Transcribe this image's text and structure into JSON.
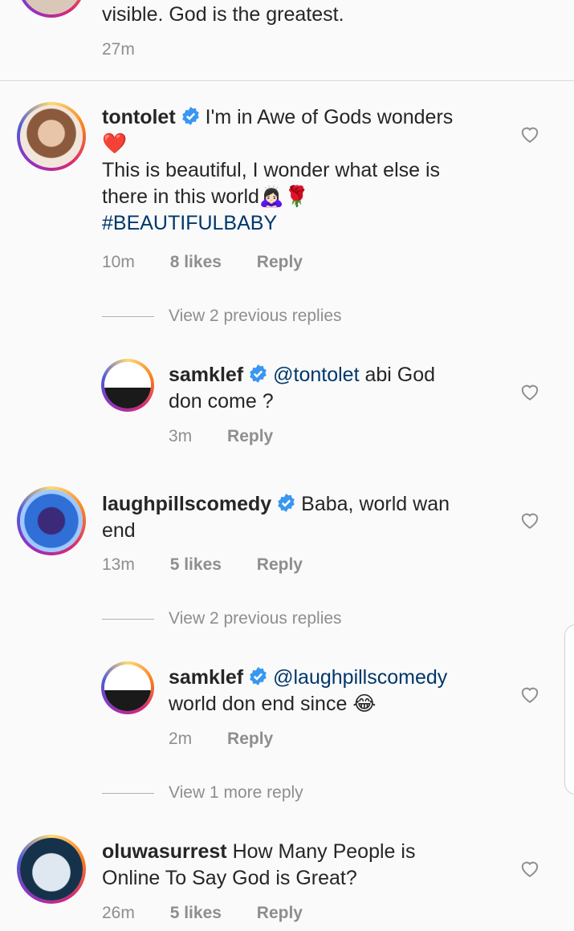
{
  "top_comment": {
    "text": "visible. God is the greatest.",
    "time": "27m"
  },
  "comments": [
    {
      "username": "tontolet",
      "verified": true,
      "line1": "I'm in Awe of Gods wonders",
      "line2": "❤️",
      "line3": "This is beautiful, I wonder what else is",
      "line4": "there in this world🙇🏻‍♀️🌹",
      "hashtag": "#BEAUTIFULBABY",
      "time": "10m",
      "likes": "8 likes",
      "reply": "Reply"
    },
    {
      "username": "laughpillscomedy",
      "verified": true,
      "line1": "Baba, world wan",
      "line2": "end",
      "time": "13m",
      "likes": "5 likes",
      "reply": "Reply"
    },
    {
      "username": "oluwasurrest",
      "verified": false,
      "line1": "How Many People is",
      "line2": "Online To Say God is Great?",
      "time": "26m",
      "likes": "5 likes",
      "reply": "Reply"
    }
  ],
  "replies": [
    {
      "username": "samklef",
      "verified": true,
      "mention": "@tontolet",
      "line1": "abi God",
      "line2": "don come ?",
      "time": "3m",
      "reply": "Reply"
    },
    {
      "username": "samklef",
      "verified": true,
      "mention": "@laughpillscomedy",
      "line2": "world don end since 😂",
      "time": "2m",
      "reply": "Reply"
    }
  ],
  "view_replies": [
    "View 2 previous replies",
    "View 2 previous replies",
    "View 1 more reply"
  ],
  "colors": {
    "accent_link": "#00376b",
    "verified": "#3897f0",
    "muted": "#8e8e8e",
    "heart_red": "#ed4956"
  },
  "icons": [
    "heart-outline-icon",
    "verified-badge-icon"
  ]
}
